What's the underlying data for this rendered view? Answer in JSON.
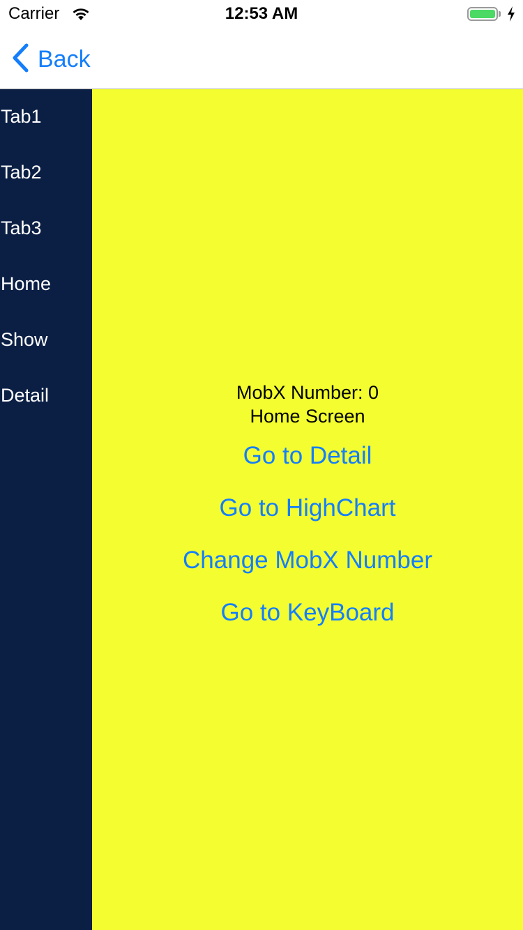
{
  "status_bar": {
    "carrier": "Carrier",
    "time": "12:53 AM",
    "battery_color": "#4cd964"
  },
  "nav": {
    "back_label": "Back",
    "accent_color": "#147efb"
  },
  "sidebar": {
    "background": "#0b1f45",
    "items": [
      {
        "label": "Tab1"
      },
      {
        "label": "Tab2"
      },
      {
        "label": "Tab3"
      },
      {
        "label": "Home"
      },
      {
        "label": "Show"
      },
      {
        "label": "Detail"
      }
    ]
  },
  "main": {
    "background": "#f3fd2f",
    "mobx_number_text": "MobX Number: 0",
    "screen_title": "Home Screen",
    "buttons": [
      {
        "label": "Go to Detail"
      },
      {
        "label": "Go to HighChart"
      },
      {
        "label": "Change MobX Number"
      },
      {
        "label": "Go to KeyBoard"
      }
    ]
  }
}
